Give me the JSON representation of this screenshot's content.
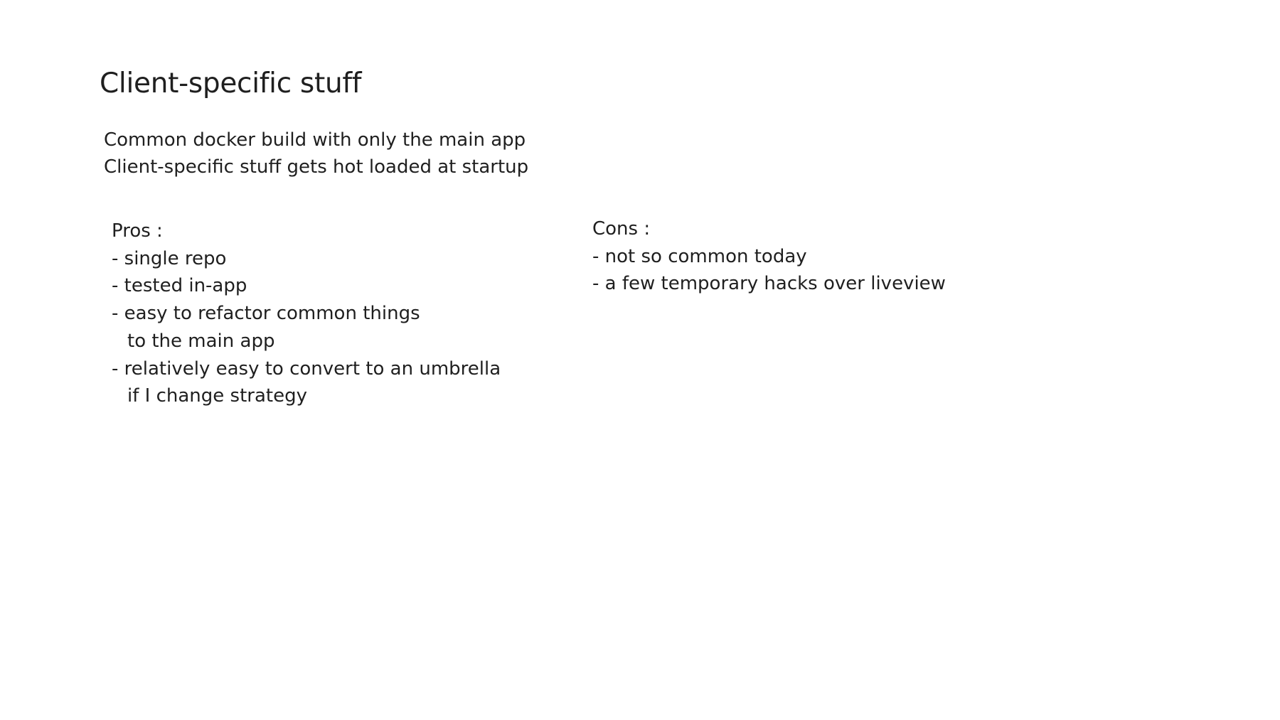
{
  "slide": {
    "title": "Client-specific stuff",
    "intro": [
      "Common docker build with only the main app",
      "Client-specific stuff gets hot loaded at startup"
    ],
    "pros": {
      "heading": "Pros :",
      "items": [
        {
          "line1": "- single repo"
        },
        {
          "line1": "- tested in-app"
        },
        {
          "line1": "- easy to refactor common things",
          "line2": "to the main app"
        },
        {
          "line1": "- relatively easy to convert to an umbrella",
          "line2": "if I change strategy"
        }
      ]
    },
    "cons": {
      "heading": "Cons :",
      "items": [
        {
          "line1": "- not so common today"
        },
        {
          "line1": "- a few temporary hacks over liveview"
        }
      ]
    }
  }
}
